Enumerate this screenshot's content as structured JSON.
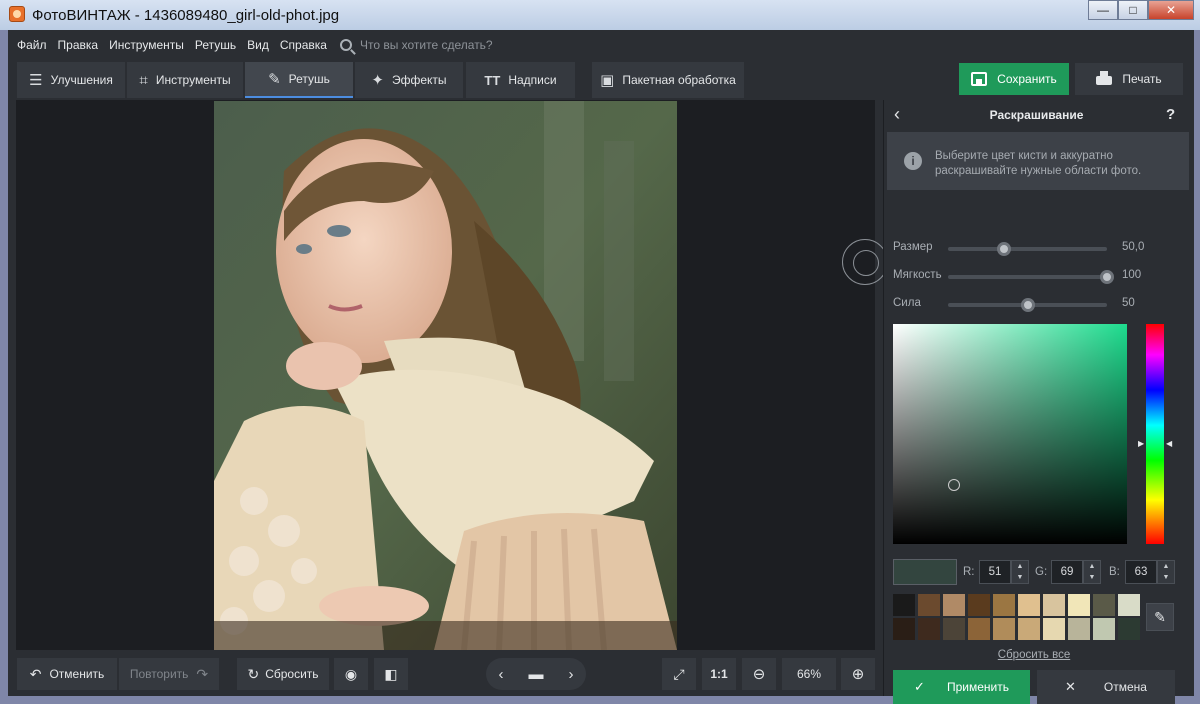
{
  "window": {
    "title": "ФотоВИНТАЖ - 1436089480_girl-old-phot.jpg",
    "minimize": "—",
    "maximize": "□",
    "close": "✕"
  },
  "menu": {
    "items": [
      "Файл",
      "Правка",
      "Инструменты",
      "Ретушь",
      "Вид",
      "Справка"
    ],
    "search_placeholder": "Что вы хотите сделать?"
  },
  "toolbar": {
    "tabs": [
      {
        "label": "Улучшения",
        "icon": "sliders-icon"
      },
      {
        "label": "Инструменты",
        "icon": "crop-icon"
      },
      {
        "label": "Ретушь",
        "icon": "brush-icon",
        "active": true
      },
      {
        "label": "Эффекты",
        "icon": "magic-wand-icon"
      },
      {
        "label": "Надписи",
        "icon": "text-icon"
      }
    ],
    "batch_label": "Пакетная обработка",
    "save_label": "Сохранить",
    "print_label": "Печать"
  },
  "bottom": {
    "undo_label": "Отменить",
    "redo_label": "Повторить",
    "reset_label": "Сбросить",
    "zoom_one": "1:1",
    "zoom_value": "66%"
  },
  "panel": {
    "title": "Раскрашивание",
    "help": "?",
    "info": "Выберите цвет кисти и аккуратно раскрашивайте нужные области фото.",
    "sliders": [
      {
        "label": "Размер",
        "value": "50,0",
        "fraction": 0.35
      },
      {
        "label": "Мягкость",
        "value": "100",
        "fraction": 1.0
      },
      {
        "label": "Сила",
        "value": "50",
        "fraction": 0.5
      }
    ],
    "picker": {
      "saturation": 0.26,
      "value": 0.27,
      "hue_position": 0.55
    },
    "rgb": {
      "r_label": "R:",
      "r": "51",
      "g_label": "G:",
      "g": "69",
      "b_label": "B:",
      "b": "63"
    },
    "current_color": "#33453f",
    "palette": [
      "#1a1a1a",
      "#6b4a2e",
      "#b08a66",
      "#5a3b1e",
      "#9b7642",
      "#e0c08f",
      "#d8c49e",
      "#f1e6b8",
      "#5a5a48",
      "#d9dcc8",
      "#2a1e16",
      "#3e2a1e",
      "#4c4438",
      "#8c6438",
      "#b08c5a",
      "#c9a978",
      "#e6d8b0",
      "#b8b49a",
      "#c0c8b0",
      "#2c3a32"
    ],
    "reset_all": "Сбросить все",
    "apply_label": "Применить",
    "cancel_label": "Отмена"
  }
}
